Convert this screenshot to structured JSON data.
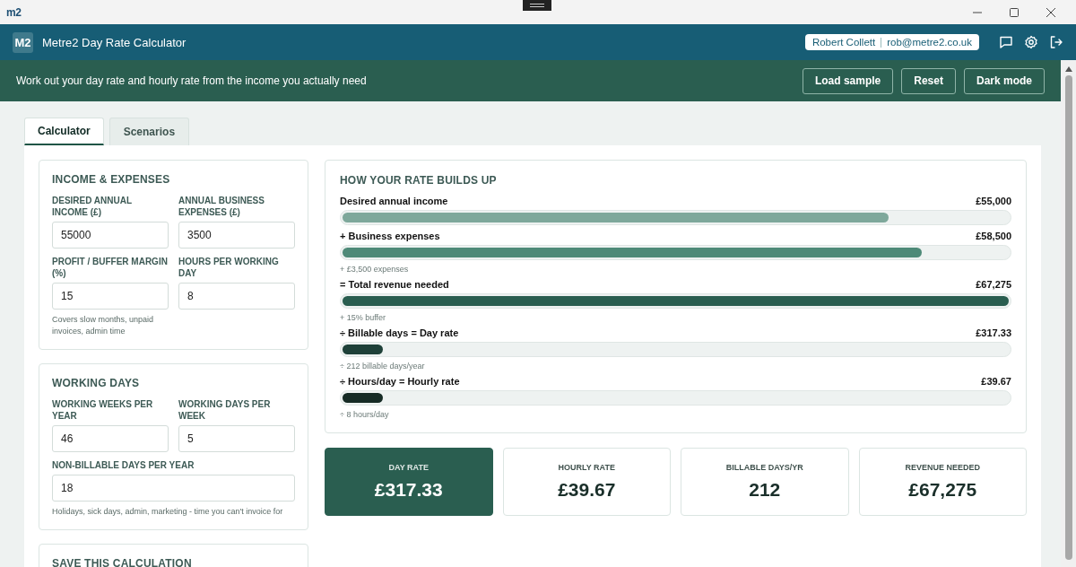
{
  "titlebar": {
    "logo": "m2"
  },
  "header": {
    "badge": "M2",
    "title": "Metre2 Day Rate Calculator",
    "user_name": "Robert Collett",
    "user_email": "rob@metre2.co.uk"
  },
  "banner": {
    "text": "Work out your day rate and hourly rate from the income you actually need",
    "buttons": [
      "Load sample",
      "Reset",
      "Dark mode"
    ]
  },
  "tabs": [
    {
      "label": "Calculator",
      "selected": true
    },
    {
      "label": "Scenarios",
      "selected": false
    }
  ],
  "sections": [
    {
      "title": "INCOME & EXPENSES",
      "fields": [
        {
          "label": "DESIRED ANNUAL INCOME (£)",
          "value": "55000",
          "wide": false
        },
        {
          "label": "ANNUAL BUSINESS EXPENSES (£)",
          "value": "3500",
          "wide": false
        },
        {
          "label": "PROFIT / BUFFER MARGIN (%)",
          "value": "15",
          "hint": "Covers slow months, unpaid invoices, admin time",
          "wide": false
        },
        {
          "label": "HOURS PER WORKING DAY",
          "value": "8",
          "wide": false
        }
      ]
    },
    {
      "title": "WORKING DAYS",
      "fields": [
        {
          "label": "WORKING WEEKS PER YEAR",
          "value": "46",
          "wide": false
        },
        {
          "label": "WORKING DAYS PER WEEK",
          "value": "5",
          "wide": false
        },
        {
          "label": "NON-BILLABLE DAYS PER YEAR",
          "value": "18",
          "hint": "Holidays, sick days, admin, marketing - time you can't invoice for",
          "wide": true
        }
      ]
    },
    {
      "title": "SAVE THIS CALCULATION"
    }
  ],
  "breakdown": {
    "title": "HOW YOUR RATE BUILDS UP",
    "steps": [
      {
        "label": "Desired annual income",
        "amount": "£55,000",
        "level": 0.82,
        "color": "#7ea89b"
      },
      {
        "label": "+ Business expenses",
        "amount": "£58,500",
        "level": 0.87,
        "color": "#4e8a78",
        "note": "+ £3,500 expenses"
      },
      {
        "label": "= Total revenue needed",
        "amount": "£67,275",
        "level": 1,
        "color": "#2a5e50",
        "note": "+ 15% buffer"
      },
      {
        "label": "÷ Billable days = Day rate",
        "amount": "£317.33",
        "level": 0.06,
        "color": "#1f4139",
        "note": "÷ 212 billable days/year"
      },
      {
        "label": "÷ Hours/day = Hourly rate",
        "amount": "£39.67",
        "level": 0.06,
        "color": "#162b25",
        "note": "÷ 8 hours/day"
      }
    ]
  },
  "stats": [
    {
      "label": "DAY RATE",
      "value": "£317.33",
      "highlighted": true
    },
    {
      "label": "HOURLY RATE",
      "value": "£39.67",
      "highlighted": false
    },
    {
      "label": "BILLABLE DAYS/YR",
      "value": "212",
      "highlighted": false
    },
    {
      "label": "REVENUE NEEDED",
      "value": "£67,275",
      "highlighted": false
    }
  ]
}
